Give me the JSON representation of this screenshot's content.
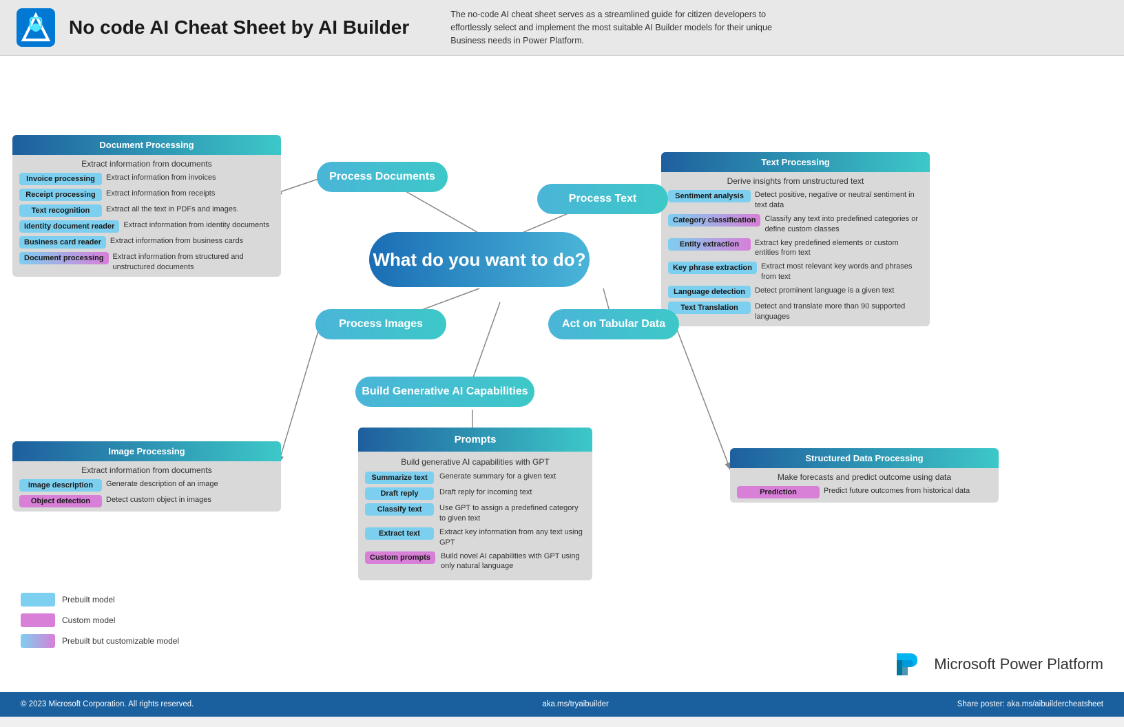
{
  "header": {
    "title": "No code AI Cheat Sheet by AI Builder",
    "description": "The no-code AI cheat sheet serves as a streamlined guide for citizen developers to effortlessly select and implement the most suitable AI Builder models for their unique Business needs in Power Platform."
  },
  "docProcessing": {
    "title": "Document Processing",
    "subtitle": "Extract information from documents",
    "items": [
      {
        "tag": "Invoice processing",
        "desc": "Extract information from invoices",
        "type": "blue"
      },
      {
        "tag": "Receipt processing",
        "desc": "Extract information from receipts",
        "type": "blue"
      },
      {
        "tag": "Text  recognition",
        "desc": "Extract all the text in PDFs and images.",
        "type": "blue"
      },
      {
        "tag": "Identity document reader",
        "desc": "Extract information from identity documents",
        "type": "blue"
      },
      {
        "tag": "Business card reader",
        "desc": "Extract information from business cards",
        "type": "blue"
      },
      {
        "tag": "Document processing",
        "desc": "Extract information from structured and unstructured documents",
        "type": "gradient"
      }
    ]
  },
  "textProcessing": {
    "title": "Text Processing",
    "subtitle": "Derive insights from unstructured text",
    "items": [
      {
        "tag": "Sentiment analysis",
        "desc": "Detect positive, negative or neutral sentiment in text data",
        "type": "blue"
      },
      {
        "tag": "Category classification",
        "desc": "Classify any text into predefined categories or define custom classes",
        "type": "gradient"
      },
      {
        "tag": "Entity extraction",
        "desc": "Extract key predefined elements or custom entities from text",
        "type": "gradient"
      },
      {
        "tag": "Key phrase extraction",
        "desc": "Extract most relevant key words and phrases from text",
        "type": "blue"
      },
      {
        "tag": "Language detection",
        "desc": "Detect prominent language is a given text",
        "type": "blue"
      },
      {
        "tag": "Text Translation",
        "desc": "Detect and translate more than 90 supported languages",
        "type": "blue"
      }
    ]
  },
  "imageProcessing": {
    "title": "Image Processing",
    "subtitle": "Extract information from documents",
    "items": [
      {
        "tag": "Image description",
        "desc": "Generate description of an image",
        "type": "blue"
      },
      {
        "tag": "Object detection",
        "desc": "Detect custom object in images",
        "type": "purple"
      }
    ]
  },
  "structuredData": {
    "title": "Structured Data Processing",
    "subtitle": "Make forecasts and predict outcome using data",
    "items": [
      {
        "tag": "Prediction",
        "desc": "Predict future outcomes from historical data",
        "type": "purple"
      }
    ]
  },
  "prompts": {
    "title": "Prompts",
    "subtitle": "Build generative AI capabilities with GPT",
    "items": [
      {
        "tag": "Summarize text",
        "desc": "Generate summary for a given text",
        "type": "blue"
      },
      {
        "tag": "Draft reply",
        "desc": "Draft reply for incoming text",
        "type": "blue"
      },
      {
        "tag": "Classify text",
        "desc": "Use GPT to assign a predefined category to given text",
        "type": "blue"
      },
      {
        "tag": "Extract text",
        "desc": "Extract key information from any text using GPT",
        "type": "blue"
      },
      {
        "tag": "Custom prompts",
        "desc": "Build novel AI capabilities with GPT using only natural language",
        "type": "purple"
      }
    ]
  },
  "centerNodes": {
    "main": "What do you want to do?",
    "processDocuments": "Process Documents",
    "processText": "Process Text",
    "processImages": "Process Images",
    "actTabular": "Act on Tabular Data",
    "buildGenAI": "Build Generative AI Capabilities"
  },
  "legend": [
    {
      "label": "Prebuilt model",
      "type": "blue"
    },
    {
      "label": "Custom model",
      "type": "purple"
    },
    {
      "label": "Prebuilt but customizable model",
      "type": "gradient"
    }
  ],
  "footer": {
    "copyright": "© 2023 Microsoft Corporation. All rights reserved.",
    "link": "aka.ms/tryaibuilder",
    "share": "Share poster: aka.ms/aibuildercheatsheet"
  },
  "powerPlatform": "Microsoft Power Platform"
}
